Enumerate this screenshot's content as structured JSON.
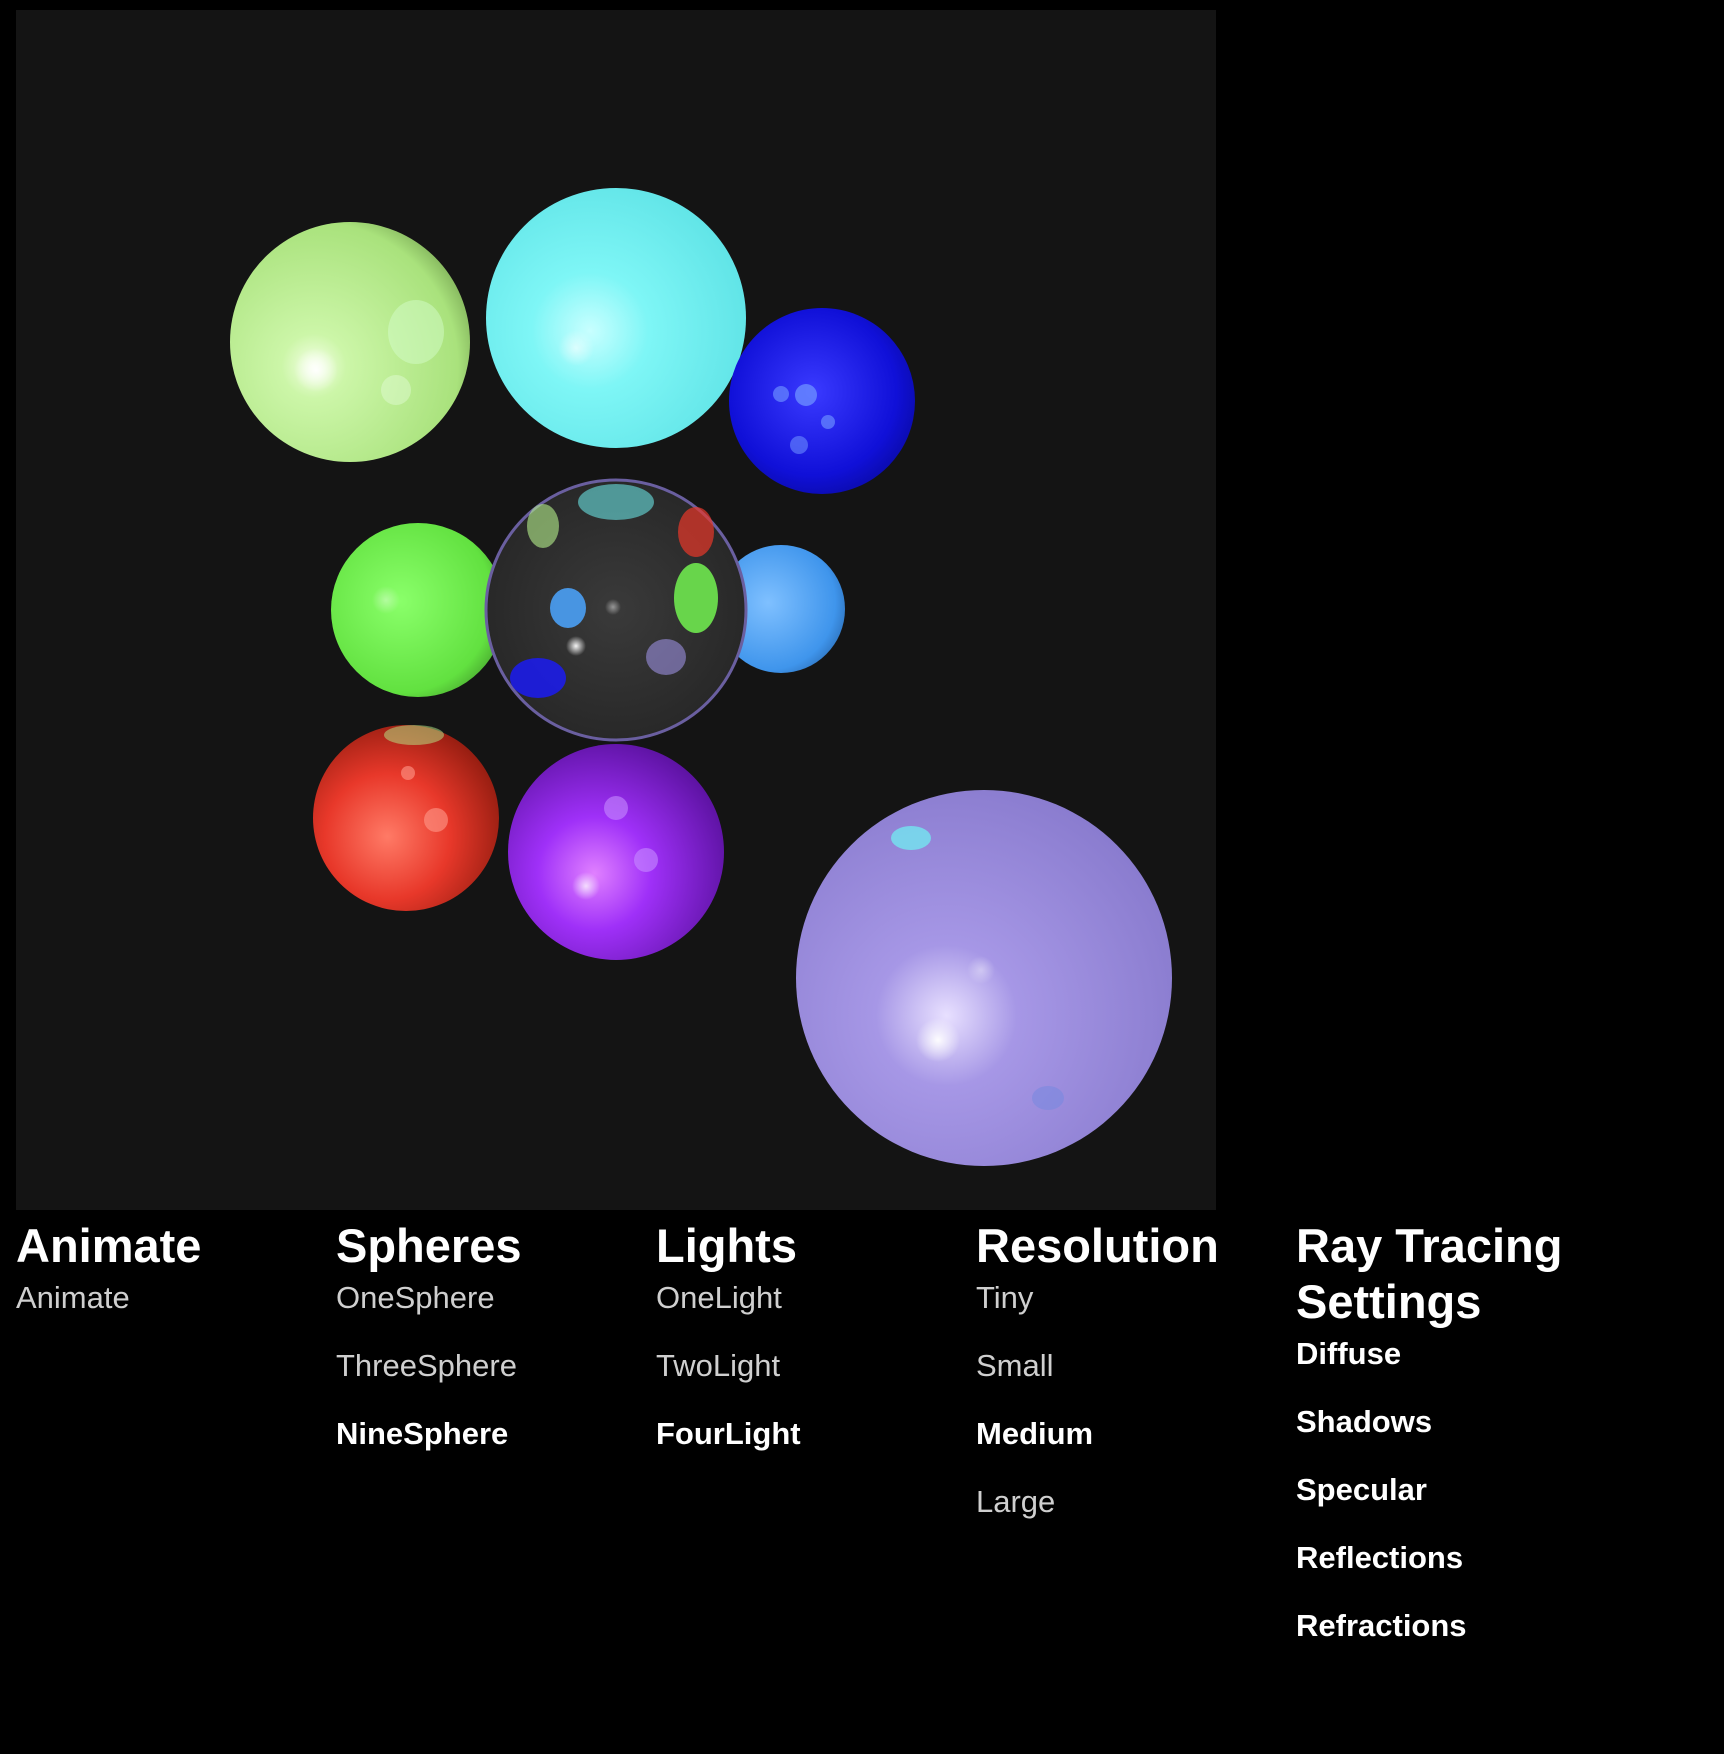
{
  "viewport": {
    "background": "#141414",
    "spheres": [
      {
        "name": "lime-sphere",
        "color": "#b6f08c"
      },
      {
        "name": "cyan-sphere",
        "color": "#6ff3f3"
      },
      {
        "name": "blue-sphere",
        "color": "#1a1aff"
      },
      {
        "name": "green-sphere",
        "color": "#6fe84f"
      },
      {
        "name": "glass-sphere",
        "color": "#2e2e2e"
      },
      {
        "name": "skyblue-sphere",
        "color": "#4aa0f5"
      },
      {
        "name": "red-sphere",
        "color": "#e83a2a"
      },
      {
        "name": "violet-sphere",
        "color": "#9a2cf5"
      },
      {
        "name": "lavender-sphere",
        "color": "#9b8fe0"
      }
    ]
  },
  "animate": {
    "heading": "Animate",
    "options": [
      {
        "label": "Animate",
        "selected": false
      }
    ]
  },
  "spheres": {
    "heading": "Spheres",
    "options": [
      {
        "label": "OneSphere",
        "selected": false
      },
      {
        "label": "ThreeSphere",
        "selected": false
      },
      {
        "label": "NineSphere",
        "selected": true
      }
    ]
  },
  "lights": {
    "heading": "Lights",
    "options": [
      {
        "label": "OneLight",
        "selected": false
      },
      {
        "label": "TwoLight",
        "selected": false
      },
      {
        "label": "FourLight",
        "selected": true
      }
    ]
  },
  "resolution": {
    "heading": "Resolution",
    "options": [
      {
        "label": "Tiny",
        "selected": false
      },
      {
        "label": "Small",
        "selected": false
      },
      {
        "label": "Medium",
        "selected": true
      },
      {
        "label": "Large",
        "selected": false
      }
    ]
  },
  "settings": {
    "heading_line1": "Ray Tracing",
    "heading_line2": "Settings",
    "options": [
      {
        "label": "Diffuse",
        "enabled": true
      },
      {
        "label": "Shadows",
        "enabled": true
      },
      {
        "label": "Specular",
        "enabled": true
      },
      {
        "label": "Reflections",
        "enabled": true
      },
      {
        "label": "Refractions",
        "enabled": true
      }
    ]
  }
}
